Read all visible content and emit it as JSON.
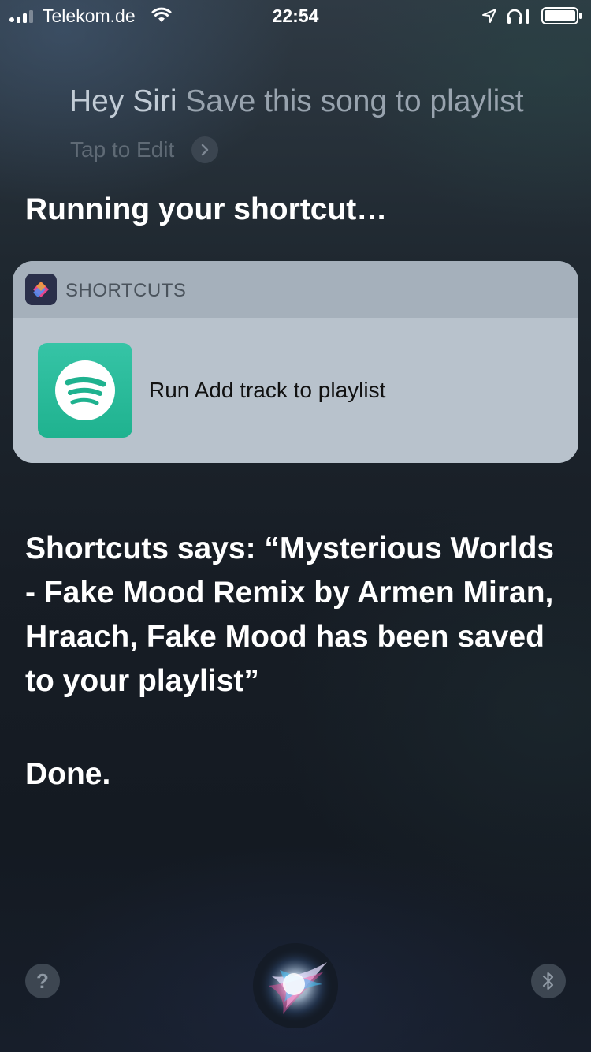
{
  "status_bar": {
    "carrier": "Telekom.de",
    "time": "22:54",
    "signal_bars": 3,
    "battery_level": 1.0
  },
  "siri": {
    "query_start": "Hey Siri",
    "query_end": " Save this song to playlist",
    "tap_to_edit": "Tap to Edit",
    "running_heading": "Running your shortcut…",
    "response": "Shortcuts says: “Mysterious Worlds - Fake Mood Remix by Armen Miran, Hraach, Fake Mood has been saved to your playlist”",
    "done": "Done."
  },
  "card": {
    "app_name": "SHORTCUTS",
    "app_icon": "shortcuts-icon",
    "action_label": "Run Add track to playlist",
    "action_icon": "spotify-icon",
    "action_color": "#1fb28f"
  },
  "bottom": {
    "help_label": "?",
    "help_icon": "help-icon",
    "center_icon": "siri-orb-icon",
    "right_icon": "bluetooth-icon"
  }
}
